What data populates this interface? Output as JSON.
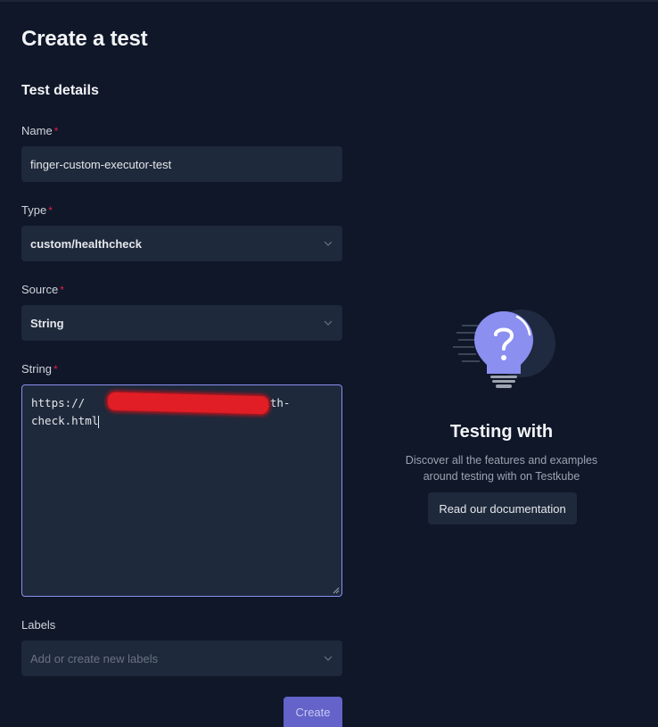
{
  "page": {
    "title": "Create a test",
    "section_title": "Test details"
  },
  "form": {
    "required_marker": "*",
    "name": {
      "label": "Name",
      "value": "finger-custom-executor-test"
    },
    "type": {
      "label": "Type",
      "value": "custom/healthcheck",
      "icon": "chevron-down-icon"
    },
    "source": {
      "label": "Source",
      "value": "String",
      "icon": "chevron-down-icon"
    },
    "string": {
      "label": "String",
      "line1_prefix": "https://",
      "line1_suffix": "/health-",
      "line2": "check.html"
    },
    "labels": {
      "label": "Labels",
      "placeholder": "Add or create new labels",
      "icon": "chevron-down-icon"
    },
    "create_label": "Create"
  },
  "promo": {
    "icon": "lightbulb-question-icon",
    "title": "Testing with",
    "text_line1": "Discover all the features and examples",
    "text_line2": "around testing with on Testkube",
    "button_label": "Read our documentation"
  },
  "colors": {
    "background": "#0f1729",
    "field_background": "#1e293b",
    "accent": "#6363c9",
    "focus_border": "#8b8ff0",
    "required": "#e11d48",
    "bulb": "#8b8ff0"
  }
}
